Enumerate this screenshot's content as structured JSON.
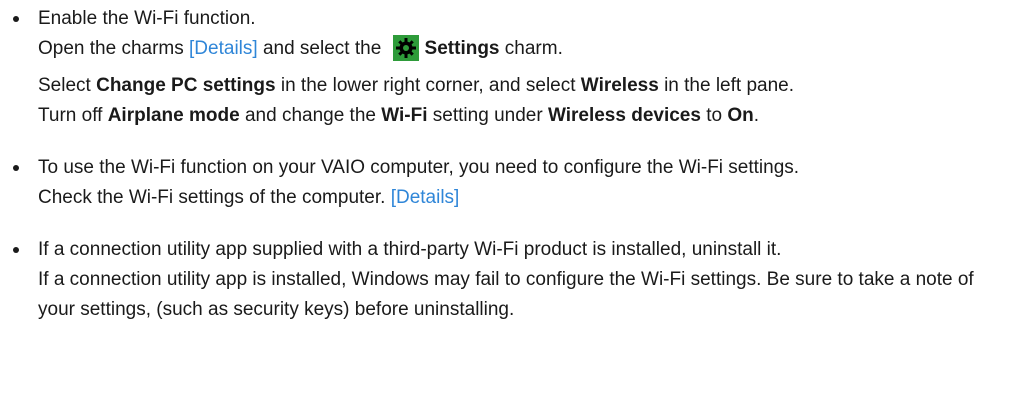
{
  "items": [
    {
      "lead": "Enable the Wi-Fi function.",
      "charms": {
        "open_text": "Open the charms ",
        "details_link": "[Details]",
        "select_text": " and select the ",
        "settings": "Settings",
        "charm_text": " charm."
      },
      "change_pc": {
        "t1": "Select ",
        "b1": "Change PC settings",
        "t2": " in the lower right corner, and select ",
        "b2": "Wireless",
        "t3": " in the left pane."
      },
      "airplane": {
        "t1": "Turn off ",
        "b1": "Airplane mode",
        "t2": " and change the ",
        "b2": "Wi-Fi",
        "t3": " setting under ",
        "b3": "Wireless devices",
        "t4": " to ",
        "b4": "On",
        "t5": "."
      }
    },
    {
      "text": "To use the Wi-Fi function on your VAIO computer, you need to configure the Wi-Fi settings.",
      "check_text": "Check the Wi-Fi settings of the computer. ",
      "details_link": "[Details]"
    },
    {
      "line1": "If a connection utility app supplied with a third-party Wi-Fi product is installed, uninstall it.",
      "line2": "If a connection utility app is installed, Windows may fail to configure the Wi-Fi settings. Be sure to take a note of your settings, (such as security keys) before uninstalling."
    }
  ],
  "icons": {
    "settings_icon": "gear-icon",
    "settings_icon_color": "#2e9b3a"
  },
  "colors": {
    "link": "#2f86d8",
    "text": "#1a1a1a"
  }
}
